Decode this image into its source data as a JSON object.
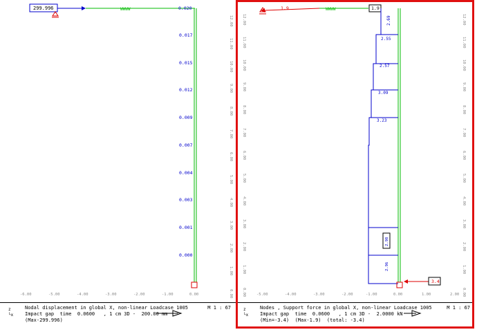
{
  "left": {
    "top_value": "299.996",
    "spring_label": "WWWW",
    "top_right_value": "0.020",
    "axis_values": [
      "0.017",
      "0.015",
      "0.012",
      "0.009",
      "0.007",
      "0.004",
      "0.003",
      "0.001",
      "0.000"
    ],
    "x_ticks": [
      "-6.00",
      "-5.00",
      "-4.00",
      "-3.00",
      "-2.00",
      "-1.00",
      "0.00"
    ],
    "y_ticks": [
      "12.00",
      "11.00",
      "10.00",
      "9.00",
      "8.00",
      "7.00",
      "6.00",
      "5.00",
      "4.00",
      "3.00",
      "2.00",
      "1.00",
      "0.00"
    ],
    "footer": {
      "line1": "Nodal displacement in global X, non-linear Loadcase 1005",
      "line2": "Impact gap  time  0.0600   , 1 cm 3D -  200.00 mm",
      "line3": "(Max-299.996)",
      "scale": "M 1 : 67",
      "axis_z": "z",
      "axis_x": "x"
    }
  },
  "right": {
    "top_left_value": "1.9",
    "spring_label": "WWWW",
    "top_box_value": "1.9",
    "stair_labels": [
      "2.69",
      "2.55",
      "2.57",
      "3.09",
      "3.23"
    ],
    "lower_labels": [
      "2.98",
      "2.96"
    ],
    "support_value": "3.4",
    "x_ticks": [
      "-5.00",
      "-4.00",
      "-3.00",
      "-2.00",
      "-1.00",
      "0.00",
      "1.00",
      "2.00"
    ],
    "y_ticks": [
      "12.00",
      "11.00",
      "10.00",
      "9.00",
      "8.00",
      "7.00",
      "6.00",
      "5.00",
      "4.00",
      "3.00",
      "2.00",
      "1.00",
      "0.00"
    ],
    "footer": {
      "line1": "Nodes , Support force in global X, non-linear Loadcase 1005",
      "line2": "Impact gap  time  0.0600   , 1 cm 3D -  2.0000 kN",
      "line3": "(Min=-3.4)  (Max-1.9)  (total: -3.4)",
      "scale": "M 1 : 67",
      "axis_z": "z",
      "axis_x": "x"
    }
  },
  "colors": {
    "structure": "#00bb00",
    "value": "#0000cc",
    "support": "#dd0000",
    "frame": "#e01010"
  }
}
